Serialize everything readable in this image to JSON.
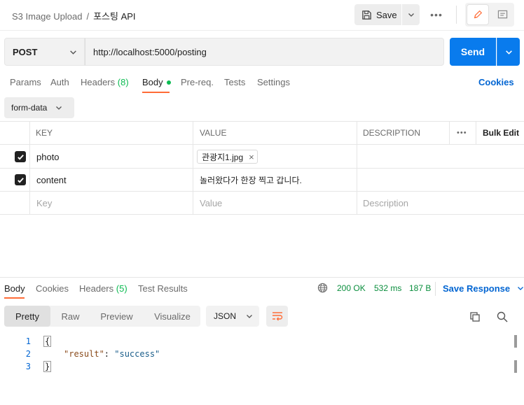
{
  "header": {
    "collection": "S3 Image Upload",
    "separator": "/",
    "request_name": "포스팅 API",
    "save_label": "Save",
    "more_label": "•••"
  },
  "request": {
    "method": "POST",
    "url": "http://localhost:5000/posting",
    "send_label": "Send"
  },
  "request_tabs": {
    "params": "Params",
    "auth": "Auth",
    "headers": "Headers",
    "headers_count": "(8)",
    "body": "Body",
    "prereq": "Pre-req.",
    "tests": "Tests",
    "settings": "Settings",
    "cookies": "Cookies",
    "active": "Body"
  },
  "body_type": "form-data",
  "table": {
    "headers": {
      "key": "KEY",
      "value": "VALUE",
      "description": "DESCRIPTION",
      "more": "•••",
      "bulk_edit": "Bulk Edit"
    },
    "rows": [
      {
        "checked": true,
        "key": "photo",
        "value": "관광지1.jpg",
        "value_type": "file",
        "remove": "×"
      },
      {
        "checked": true,
        "key": "content",
        "value": "놀러왔다가 한장 찍고 갑니다.",
        "value_type": "text"
      }
    ],
    "placeholders": {
      "key": "Key",
      "value": "Value",
      "description": "Description"
    }
  },
  "response_tabs": {
    "body": "Body",
    "cookies": "Cookies",
    "headers": "Headers",
    "headers_count": "(5)",
    "test_results": "Test Results",
    "active": "Body"
  },
  "response_meta": {
    "status": "200 OK",
    "time": "532 ms",
    "size": "187 B",
    "save_response": "Save Response"
  },
  "view_modes": {
    "pretty": "Pretty",
    "raw": "Raw",
    "preview": "Preview",
    "visualize": "Visualize",
    "active": "Pretty",
    "format": "JSON"
  },
  "response_body": {
    "line_numbers": [
      "1",
      "2",
      "3"
    ],
    "open_brace": "{",
    "key": "\"result\"",
    "colon": ": ",
    "value": "\"success\"",
    "close_brace": "}"
  },
  "colors": {
    "accent": "#ff6c37",
    "primary": "#097bed",
    "link": "#0265d2",
    "success": "#0cbb52",
    "status_text": "#0a8e3d"
  }
}
